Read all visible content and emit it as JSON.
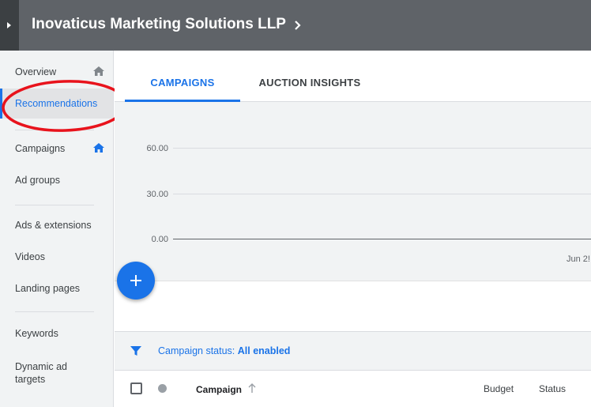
{
  "header": {
    "account_name": "Inovaticus Marketing Solutions LLP"
  },
  "sidebar": {
    "items": [
      {
        "label": "Overview",
        "icon": "home-icon"
      },
      {
        "label": "Recommendations"
      },
      {
        "label": "Campaigns",
        "icon": "home-icon"
      },
      {
        "label": "Ad groups"
      },
      {
        "label": "Ads & extensions"
      },
      {
        "label": "Videos"
      },
      {
        "label": "Landing pages"
      },
      {
        "label": "Keywords"
      },
      {
        "label": "Dynamic ad targets"
      }
    ],
    "active_item": "Recommendations"
  },
  "tabs": [
    {
      "label": "CAMPAIGNS",
      "active": true
    },
    {
      "label": "AUCTION INSIGHTS",
      "active": false
    }
  ],
  "chart": {
    "y_ticks": [
      "60.00",
      "30.00",
      "0.00"
    ],
    "x_tick": "Jun 2!"
  },
  "filter": {
    "prefix": "Campaign status: ",
    "value": "All enabled"
  },
  "table": {
    "columns": [
      "Campaign",
      "Budget",
      "Status"
    ]
  },
  "colors": {
    "header_bg": "#5f6368",
    "accent": "#1a73e8",
    "annotation": "#e8131c"
  }
}
